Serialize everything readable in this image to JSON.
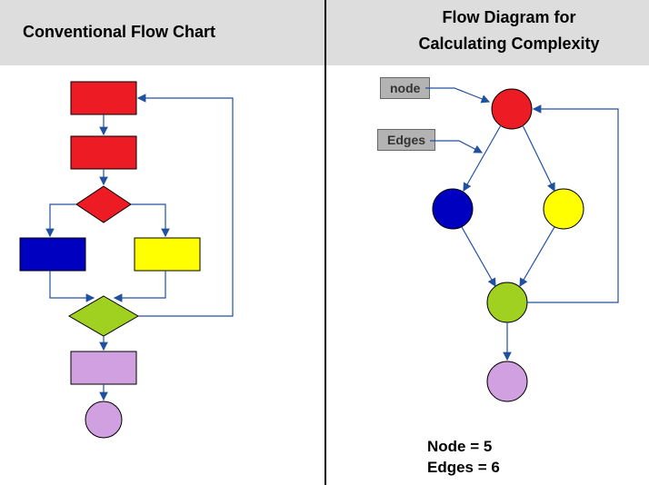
{
  "left": {
    "title": "Conventional Flow Chart"
  },
  "right": {
    "title_line1": "Flow Diagram for",
    "title_line2": "Calculating Complexity",
    "label_node": "node",
    "label_edges": "Edges",
    "stats_node": "Node  = 5",
    "stats_edges": "Edges = 6"
  },
  "colors": {
    "red": "#ed1c24",
    "blue": "#0000c0",
    "yellow": "#ffff00",
    "green": "#a0d020",
    "purple": "#d0a0e0",
    "arrow": "#2050a0"
  }
}
